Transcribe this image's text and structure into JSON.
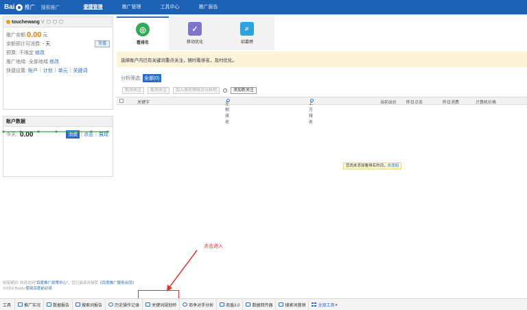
{
  "brand": {
    "logo_text": "Bai",
    "logo_after": "",
    "sub": "推广",
    "search": "搜索推广"
  },
  "nav": [
    {
      "label": "便捷管理",
      "active": true
    },
    {
      "label": "推广管理"
    },
    {
      "label": "工具中心"
    },
    {
      "label": "推广报告"
    }
  ],
  "account": {
    "username": "touchewang",
    "v_badge": "V",
    "balance_label": "推广余额:",
    "balance_value": "0.00",
    "balance_unit": "元",
    "days_label": "余额预计可消费:",
    "days_value": "- 天",
    "recharge_label": "充值",
    "budget_label": "预算:",
    "budget_value": "不限定",
    "budget_edit": "修改",
    "region_label": "推广地域:",
    "region_value": "全部地域",
    "region_edit": "修改",
    "quick_label": "快捷设置:",
    "quick_links": [
      "账户",
      "计划",
      "单元",
      "关键词"
    ]
  },
  "data_panel": {
    "title": "账户数据",
    "today_label": "今天:",
    "today_value": "0.00",
    "tabs": [
      "消费",
      "点击",
      "展现"
    ],
    "active_tab": "消费"
  },
  "feature_tabs": [
    {
      "label": "看排名",
      "icon": "target-icon",
      "active": true
    },
    {
      "label": "移动优化",
      "icon": "mobile-check-icon"
    },
    {
      "label": "招募榜",
      "icon": "magnifier-icon"
    }
  ],
  "notice": "选择账户内已有关键词重点关注，随时看排名，及时优化。",
  "filter": {
    "label": "分析筛选:",
    "all": "全部(0)"
  },
  "actions": [
    "取消关注",
    "取消关注",
    "加入排名榜结合分析吧",
    "添加新关注"
  ],
  "table_headers": [
    "关键字",
    "左侧排名",
    "上方排名",
    "当前出价",
    "昨日点击",
    "昨日消费",
    "计算机价格"
  ],
  "empty_message": "您尚未添加看排名的词，",
  "empty_link": "去添加",
  "annotation": "点击进入",
  "footer": {
    "line1_prefix": "如有疑问: 欢迎访问",
    "line1_link1": "\"百度推广政策中心\"",
    "line1_mid": "，您已阅读并接受",
    "line1_link2": "《百度推广服务合同》",
    "line2_prefix": "©2016 Baidu",
    "line2_link": "使用百度前必读"
  },
  "tools_label": "工具",
  "tools": [
    {
      "label": "推广实况",
      "icon": "monitor-icon"
    },
    {
      "label": "数据报告",
      "icon": "report-icon"
    },
    {
      "label": "搜索词报告",
      "icon": "search-report-icon"
    },
    {
      "label": "历史操作记录",
      "icon": "history-icon"
    },
    {
      "label": "关键词规划师",
      "icon": "keyword-planner-icon"
    },
    {
      "label": "商争对手分析",
      "icon": "competitor-icon"
    },
    {
      "label": "商盾3.0",
      "icon": "shield-icon"
    },
    {
      "label": "数据回传器",
      "icon": "data-icon"
    },
    {
      "label": "搜索词营销",
      "icon": "marketing-icon"
    },
    {
      "label": "全部工具",
      "icon": "all-tools-icon"
    }
  ]
}
